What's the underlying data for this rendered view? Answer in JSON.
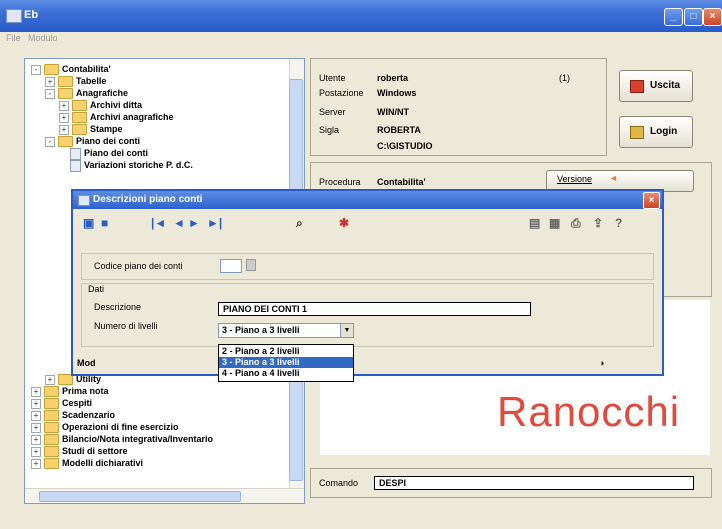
{
  "window": {
    "title": "Eb"
  },
  "menu": [
    "File",
    "Modulo"
  ],
  "tree": [
    {
      "label": "Contabilita'",
      "kind": "folder",
      "exp": "-",
      "depth": 0
    },
    {
      "label": "Tabelle",
      "kind": "folder",
      "exp": "+",
      "depth": 1
    },
    {
      "label": "Anagrafiche",
      "kind": "folder",
      "exp": "-",
      "depth": 1
    },
    {
      "label": "Archivi ditta",
      "kind": "folder",
      "exp": "+",
      "depth": 2
    },
    {
      "label": "Archivi anagrafiche",
      "kind": "folder",
      "exp": "+",
      "depth": 2
    },
    {
      "label": "Stampe",
      "kind": "folder",
      "exp": "+",
      "depth": 2
    },
    {
      "label": "Piano dei conti",
      "kind": "folder",
      "exp": "-",
      "depth": 1
    },
    {
      "label": "Piano dei conti",
      "kind": "doc",
      "exp": "",
      "depth": 2
    },
    {
      "label": "Variazioni storiche P. d.C.",
      "kind": "doc",
      "exp": "",
      "depth": 2
    },
    {
      "label": "Utility",
      "kind": "folder",
      "exp": "+",
      "depth": 1
    },
    {
      "label": "Prima nota",
      "kind": "folder",
      "exp": "+",
      "depth": 0
    },
    {
      "label": "Cespiti",
      "kind": "folder",
      "exp": "+",
      "depth": 0
    },
    {
      "label": "Scadenzario",
      "kind": "folder",
      "exp": "+",
      "depth": 0
    },
    {
      "label": "Operazioni di fine esercizio",
      "kind": "folder",
      "exp": "+",
      "depth": 0
    },
    {
      "label": "Bilancio/Nota integrativa/Inventario",
      "kind": "folder",
      "exp": "+",
      "depth": 0
    },
    {
      "label": "Studi di settore",
      "kind": "folder",
      "exp": "+",
      "depth": 0
    },
    {
      "label": "Modelli dichiarativi",
      "kind": "folder",
      "exp": "+",
      "depth": 0
    }
  ],
  "info": {
    "utente_label": "Utente",
    "utente": "roberta",
    "code": "(1)",
    "postazione_label": "Postazione",
    "postazione": "Windows",
    "server_label": "Server",
    "server": "WIN/NT",
    "sigla_label": "Sigla",
    "sigla": "ROBERTA",
    "path": "C:\\GISTUDIO"
  },
  "buttons": {
    "uscita": "Uscita",
    "login": "Login",
    "versione": "Versione"
  },
  "procedura": {
    "label": "Procedura",
    "value": "Contabilita'"
  },
  "comando": {
    "label": "Comando",
    "value": "DESPI"
  },
  "logo": "Ranocchi",
  "dialog": {
    "title": "Descrizioni piano conti",
    "codice_label": "Codice piano dei conti",
    "dati_label": "Dati",
    "descrizione_label": "Descrizione",
    "descrizione": "PIANO DEI CONTI 1",
    "livelli_label": "Numero di livelli",
    "livelli_selected": "3 - Piano a 3 livelli",
    "options": [
      "2 - Piano a 2 livelli",
      "3 - Piano a 3 livelli",
      "4 - Piano a 4 livelli"
    ],
    "highlighted_option": 1,
    "mod_label": "Mod"
  }
}
